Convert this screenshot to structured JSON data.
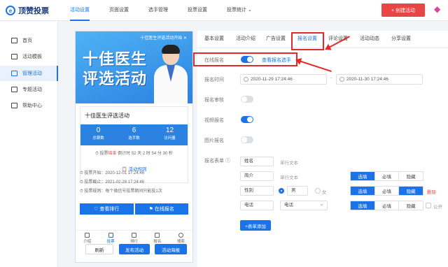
{
  "app": {
    "logo_text": "顶赞投票",
    "logo_mark": "e"
  },
  "topnav": [
    {
      "label": "活动设置"
    },
    {
      "label": "页面设置"
    },
    {
      "label": "选手管理"
    },
    {
      "label": "投票设置"
    },
    {
      "label": "投票统计 ⌄"
    }
  ],
  "create_button": "+ 创建活动",
  "sidebar": [
    {
      "label": "首页"
    },
    {
      "label": "活动模板"
    },
    {
      "label": "管理活动"
    },
    {
      "label": "专题活动"
    },
    {
      "label": "帮助中心"
    }
  ],
  "preview": {
    "banner_top": "十佳医生评选活动开始 ✕",
    "title_line1": "十佳医生",
    "title_line2": "评选活动",
    "activity_name": "十佳医生评选活动",
    "stats": [
      {
        "num": "0",
        "label": "总票数"
      },
      {
        "num": "6",
        "label": "选手数"
      },
      {
        "num": "12",
        "label": "访问量"
      }
    ],
    "countdown_prefix": "投票",
    "countdown_status": "结束",
    "countdown_rest": " 倒计时 52 天 2 时 54 分 30 秒",
    "rules_title": "活动规则",
    "rules": [
      "投票开始：2020-12-01 17:24:46",
      "投票截止：2021-02-28 17:24:46",
      "投票规则：每个微信号投票期间只能投1次"
    ],
    "btn_rank": "查看排行",
    "btn_signup": "在线报名",
    "tabs": [
      {
        "label": "介绍"
      },
      {
        "label": "投票"
      },
      {
        "label": "排行"
      },
      {
        "label": "报名"
      },
      {
        "label": "搜索"
      }
    ]
  },
  "bottom_buttons": {
    "refresh": "刷新",
    "publish": "发布活动",
    "poster": "活动海报"
  },
  "settings_tabs": [
    {
      "label": "基本设置"
    },
    {
      "label": "活动介绍"
    },
    {
      "label": "广告设置"
    },
    {
      "label": "报名设置"
    },
    {
      "label": "评论设置"
    },
    {
      "label": "活动动态"
    },
    {
      "label": "分享设置"
    }
  ],
  "signup": {
    "online_label": "在线报名",
    "view_link": "查看报名选手",
    "time_label": "报名时间",
    "time_start": "2020-11-29 17:24:46",
    "time_sep": "-",
    "time_end": "2020-11-30 17:24:46",
    "review_label": "报名审核",
    "video_label": "视频报名",
    "image_label": "图片报名",
    "form_label": "报名表单 ⓘ",
    "fields": [
      {
        "name": "姓名",
        "type": "单行文本"
      },
      {
        "name": "简介",
        "type": "单行文本",
        "opts": [
          "选填",
          "必填",
          "隐藏"
        ]
      },
      {
        "name": "性别",
        "radio_male": "男",
        "radio_female": "女",
        "opts": [
          "选填",
          "必填",
          "隐藏"
        ],
        "delete": "删除"
      },
      {
        "name": "电话",
        "select": "电话",
        "opts": [
          "选填",
          "必填",
          "隐藏"
        ],
        "public": "公开"
      }
    ],
    "add_button": "+表单添加"
  }
}
